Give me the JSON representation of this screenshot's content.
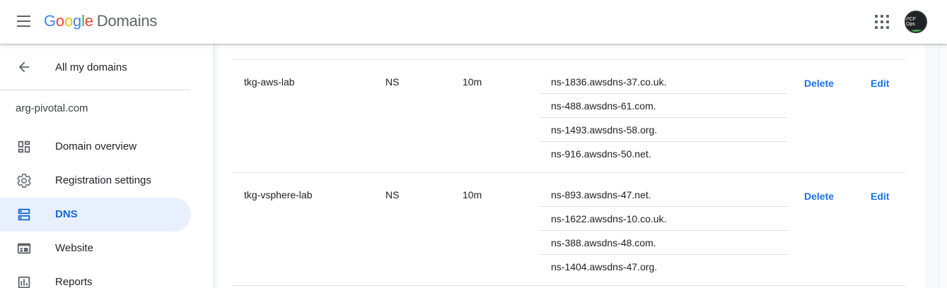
{
  "header": {
    "logo_letters": [
      "G",
      "o",
      "o",
      "g",
      "l",
      "e"
    ],
    "product": "Domains",
    "avatar_text": "PCF Ops"
  },
  "sidebar": {
    "back_label": "All my domains",
    "domain": "arg-pivotal.com",
    "items": [
      {
        "label": "Domain overview",
        "icon": "dashboard-icon"
      },
      {
        "label": "Registration settings",
        "icon": "gear-icon"
      },
      {
        "label": "DNS",
        "icon": "dns-icon",
        "active": true
      },
      {
        "label": "Website",
        "icon": "website-icon"
      },
      {
        "label": "Reports",
        "icon": "reports-icon"
      }
    ]
  },
  "records": [
    {
      "name": "tkg-aws-lab",
      "type": "NS",
      "ttl": "10m",
      "data": [
        "ns-1836.awsdns-37.co.uk.",
        "ns-488.awsdns-61.com.",
        "ns-1493.awsdns-58.org.",
        "ns-916.awsdns-50.net."
      ],
      "delete_label": "Delete",
      "edit_label": "Edit"
    },
    {
      "name": "tkg-vsphere-lab",
      "type": "NS",
      "ttl": "10m",
      "data": [
        "ns-893.awsdns-47.net.",
        "ns-1622.awsdns-10.co.uk.",
        "ns-388.awsdns-48.com.",
        "ns-1404.awsdns-47.org."
      ],
      "delete_label": "Delete",
      "edit_label": "Edit"
    }
  ],
  "colors": {
    "accent": "#1a73e8",
    "active_bg": "#e8f0fe"
  }
}
